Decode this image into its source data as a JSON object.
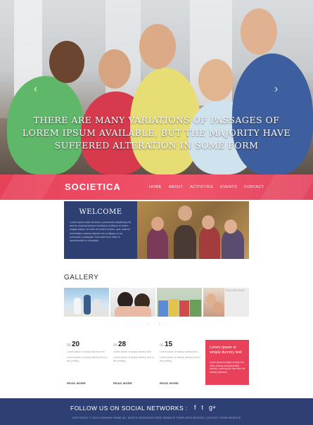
{
  "hero": {
    "headline": "THERE ARE MANY VARIATIONS OF PASSAGES OF LOREM IPSUM AVAILABLE, BUT THE MAJORITY HAVE SUFFERED ALTERATION IN SOME FORM",
    "prev_arrow": "‹",
    "next_arrow": "›"
  },
  "nav": {
    "logo": "SOCIETICA",
    "items": [
      "HOME",
      "ABOUT",
      "ACTIVITIES",
      "EVENTS",
      "CONTACT"
    ]
  },
  "welcome": {
    "title": "WELCOME",
    "text": "Lorem ipsum dolor sit amet, consectetur adipiscing elit, sed do eiusmod tempor incididunt ut labore et dolore magna aliqua. Ut enim ad minim veniam, quis nostrud exercitation ullamco laboris nisi ut aliquip ex ea commodo consequat. Duis aute irure dolor in reprehenderit in voluptate."
  },
  "gallery": {
    "title": "GALLERY",
    "caption": "Your text here",
    "prev": "‹",
    "next": "›"
  },
  "news": [
    {
      "day": "20",
      "prefix": "05",
      "line1": "Lorem ipsum is simply dummy text",
      "line2": "Lorem ipsum is simply dummy text of the printing",
      "more": "READ MORE"
    },
    {
      "day": "28",
      "prefix": "04",
      "line1": "Lorem ipsum is simply dummy text",
      "line2": "Lorem ipsum is simply dummy text of the printing",
      "more": "READ MORE"
    },
    {
      "day": "15",
      "prefix": "03",
      "line1": "Lorem ipsum is simply dummy text",
      "line2": "Lorem ipsum is simply dummy text of the printing",
      "more": "READ MORE"
    }
  ],
  "promo": {
    "headline": "Lorem Ipsum is simply dummy text",
    "text": "Lorem ipsum is simply dummy text of the printing and typesetting industry. Lorem ipsum has been the industry standard."
  },
  "footer": {
    "follow": "FOLLOW US ON SOCIAL NETWORKS :",
    "icons": [
      "f",
      "t",
      "g+"
    ],
    "copyright": "COPYRIGHT © 2020 COMPANY NAME ALL RIGHTS RESERVED   FREE WEBSITE TEMPLATES DESIGN   |   COLLECT FROM WEBSITE"
  },
  "colors": {
    "accent": "#e8415a",
    "navy": "#2e3f73"
  }
}
